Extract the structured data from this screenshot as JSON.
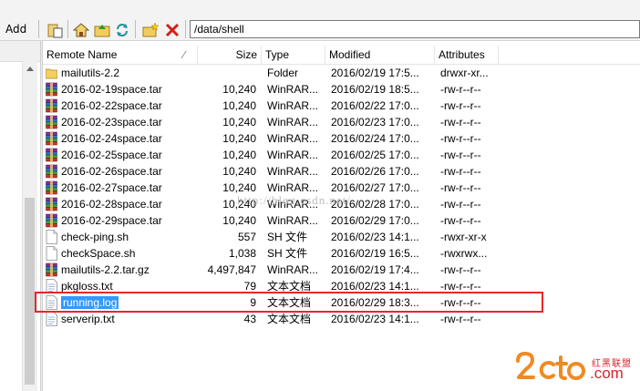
{
  "toolbar": {
    "add_label": "Add",
    "path": "/data/shell"
  },
  "columns": {
    "name": "Remote Name",
    "size": "Size",
    "type": "Type",
    "modified": "Modified",
    "attributes": "Attributes"
  },
  "files": [
    {
      "name": "mailutils-2.2",
      "size": "",
      "type": "Folder",
      "modified": "2016/02/19 17:5...",
      "attributes": "drwxr-xr...",
      "icon": "folder-icon"
    },
    {
      "name": "2016-02-19space.tar",
      "size": "10,240",
      "type": "WinRAR...",
      "modified": "2016/02/19 18:5...",
      "attributes": "-rw-r--r--",
      "icon": "winrar-archive-icon"
    },
    {
      "name": "2016-02-22space.tar",
      "size": "10,240",
      "type": "WinRAR...",
      "modified": "2016/02/22 17:0...",
      "attributes": "-rw-r--r--",
      "icon": "winrar-archive-icon"
    },
    {
      "name": "2016-02-23space.tar",
      "size": "10,240",
      "type": "WinRAR...",
      "modified": "2016/02/23 17:0...",
      "attributes": "-rw-r--r--",
      "icon": "winrar-archive-icon"
    },
    {
      "name": "2016-02-24space.tar",
      "size": "10,240",
      "type": "WinRAR...",
      "modified": "2016/02/24 17:0...",
      "attributes": "-rw-r--r--",
      "icon": "winrar-archive-icon"
    },
    {
      "name": "2016-02-25space.tar",
      "size": "10,240",
      "type": "WinRAR...",
      "modified": "2016/02/25 17:0...",
      "attributes": "-rw-r--r--",
      "icon": "winrar-archive-icon"
    },
    {
      "name": "2016-02-26space.tar",
      "size": "10,240",
      "type": "WinRAR...",
      "modified": "2016/02/26 17:0...",
      "attributes": "-rw-r--r--",
      "icon": "winrar-archive-icon"
    },
    {
      "name": "2016-02-27space.tar",
      "size": "10,240",
      "type": "WinRAR...",
      "modified": "2016/02/27 17:0...",
      "attributes": "-rw-r--r--",
      "icon": "winrar-archive-icon"
    },
    {
      "name": "2016-02-28space.tar",
      "size": "10,240",
      "type": "WinRAR...",
      "modified": "2016/02/28 17:0...",
      "attributes": "-rw-r--r--",
      "icon": "winrar-archive-icon"
    },
    {
      "name": "2016-02-29space.tar",
      "size": "10,240",
      "type": "WinRAR...",
      "modified": "2016/02/29 17:0...",
      "attributes": "-rw-r--r--",
      "icon": "winrar-archive-icon"
    },
    {
      "name": "check-ping.sh",
      "size": "557",
      "type": "SH 文件",
      "modified": "2016/02/23 14:1...",
      "attributes": "-rwxr-xr-x",
      "icon": "sh-file-icon"
    },
    {
      "name": "checkSpace.sh",
      "size": "1,038",
      "type": "SH 文件",
      "modified": "2016/02/19 16:5...",
      "attributes": "-rwxrwx...",
      "icon": "sh-file-icon"
    },
    {
      "name": "mailutils-2.2.tar.gz",
      "size": "4,497,847",
      "type": "WinRAR...",
      "modified": "2016/02/19 17:4...",
      "attributes": "-rw-r--r--",
      "icon": "winrar-archive-icon"
    },
    {
      "name": "pkgloss.txt",
      "size": "79",
      "type": "文本文档",
      "modified": "2016/02/23 14:1...",
      "attributes": "-rw-r--r--",
      "icon": "text-file-icon"
    },
    {
      "name": "running.log",
      "size": "9",
      "type": "文本文档",
      "modified": "2016/02/29 18:3...",
      "attributes": "-rw-r--r--",
      "icon": "text-file-icon",
      "selected": true
    },
    {
      "name": "serverip.txt",
      "size": "43",
      "type": "文本文档",
      "modified": "2016/02/23 14:1...",
      "attributes": "-rw-r--r--",
      "icon": "text-file-icon"
    }
  ],
  "watermark": "http://blog.csdn.net/",
  "logo": {
    "brand": "2cto",
    "domain": ".com",
    "cn": "红黑联盟"
  },
  "colors": {
    "selection": "#3399ff",
    "highlight_box": "#e8262a",
    "logo_orange": "#f08a24",
    "logo_red": "#d9232d"
  }
}
